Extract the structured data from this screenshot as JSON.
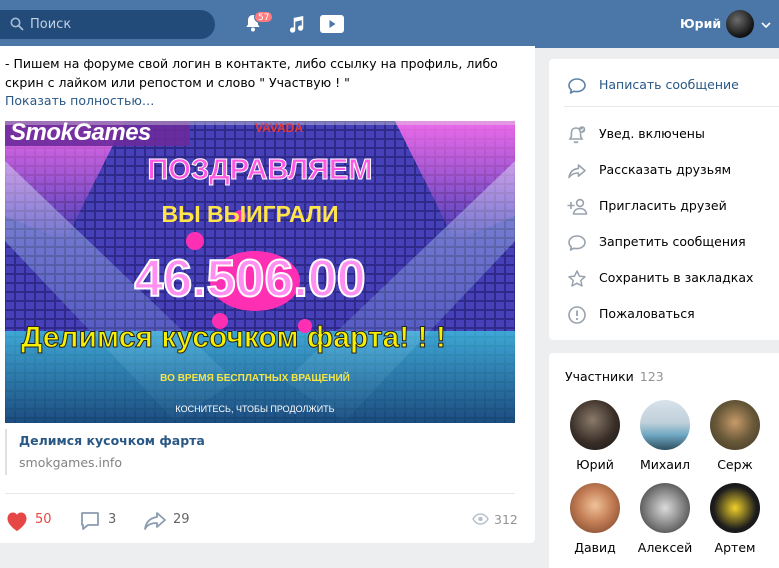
{
  "header": {
    "search_placeholder": "Поиск",
    "notifications_badge": "57",
    "user_name": "Юрий"
  },
  "post": {
    "text": "- Пишем на форуме свой логин в контакте, либо ссылку на профиль, либо скрин с лайком или репостом и слово \" Участвую ! \"",
    "show_more": "Показать полностью…",
    "banner": {
      "logo": "SmokGames",
      "brand": "VAVADA",
      "headline": "ПОЗДРАВЛЯЕМ",
      "subheadline": "ВЫ ВЫИГРАЛИ",
      "amount": "46.506.00",
      "caption": "Делимся кусочком фарта! ! !",
      "spins_line": "ВО ВРЕМЯ БЕСПЛАТНЫХ ВРАЩЕНИЙ",
      "continue_hint": "КОСНИТЕСЬ, ЧТОБЫ ПРОДОЛЖИТЬ"
    },
    "link_title": "Делимся кусочком фарта",
    "link_domain": "smokgames.info",
    "likes": "50",
    "comments": "3",
    "shares": "29",
    "views": "312",
    "colors": {
      "like": "#e64646",
      "link": "#2a5885"
    }
  },
  "menu": {
    "items": [
      {
        "label": "Написать сообщение",
        "icon": "message-icon"
      },
      {
        "label": "Увед. включены",
        "icon": "bell-check-icon"
      },
      {
        "label": "Рассказать друзьям",
        "icon": "share-icon"
      },
      {
        "label": "Пригласить друзей",
        "icon": "add-user-icon"
      },
      {
        "label": "Запретить сообщения",
        "icon": "message-block-icon"
      },
      {
        "label": "Сохранить в закладках",
        "icon": "star-icon"
      },
      {
        "label": "Пожаловаться",
        "icon": "report-icon"
      }
    ]
  },
  "members": {
    "title": "Участники",
    "count": "123",
    "list": [
      {
        "name": "Юрий"
      },
      {
        "name": "Михаил"
      },
      {
        "name": "Серж"
      },
      {
        "name": "Давид"
      },
      {
        "name": "Алексей"
      },
      {
        "name": "Артем"
      }
    ]
  }
}
